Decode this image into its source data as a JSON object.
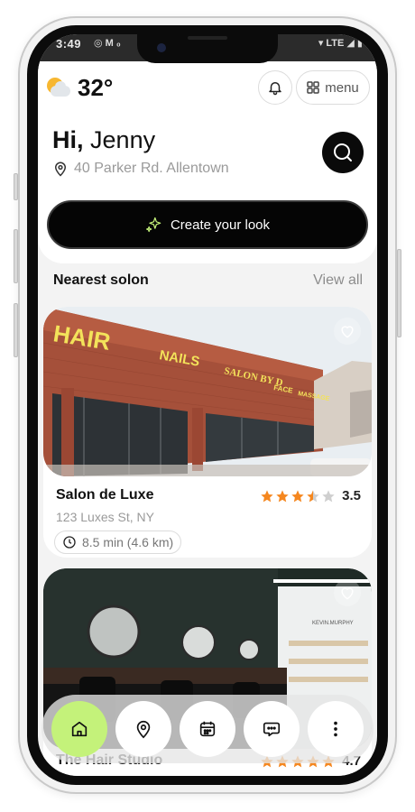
{
  "status_bar": {
    "time": "3:49",
    "left_icons": "◎ M ₀",
    "right_icons": "▾ LTE ◢ ▮"
  },
  "header": {
    "weather": {
      "icon": "partly-cloudy-icon",
      "temperature": "32°"
    },
    "notifications": {
      "icon": "bell-icon"
    },
    "menu": {
      "icon": "grid-icon",
      "label": "menu"
    },
    "greeting_bold": "Hi,",
    "greeting_name": "Jenny",
    "address": "40 Parker Rd. Allentown",
    "search": {
      "icon": "search-icon"
    },
    "create_button": {
      "icon": "sparkle-icon",
      "label": "Create your look"
    }
  },
  "nearest": {
    "title": "Nearest solon",
    "view_all": "View all",
    "salons": [
      {
        "name": "Salon de Luxe",
        "address": "123 Luxes St, NY",
        "rating": "3.5",
        "stars_value": 3.5,
        "distance": "8.5 min (4.6 km)",
        "photo_signs": [
          "HAIR",
          "NAILS",
          "SALON BY D",
          "FACE",
          "MASSAGE"
        ]
      },
      {
        "name": "The Hair Studio",
        "rating": "4.7",
        "stars_value": 4.7
      }
    ]
  },
  "bottom_nav": [
    {
      "name": "home",
      "icon": "home-icon",
      "active": true
    },
    {
      "name": "map",
      "icon": "map-pin-icon",
      "active": false
    },
    {
      "name": "calendar",
      "icon": "calendar-icon",
      "active": false
    },
    {
      "name": "messages",
      "icon": "chat-icon",
      "active": false
    },
    {
      "name": "more",
      "icon": "more-vertical-icon",
      "active": false
    }
  ],
  "colors": {
    "accent_green": "#c4f27a",
    "star": "#f5871f",
    "dark": "#050505"
  }
}
